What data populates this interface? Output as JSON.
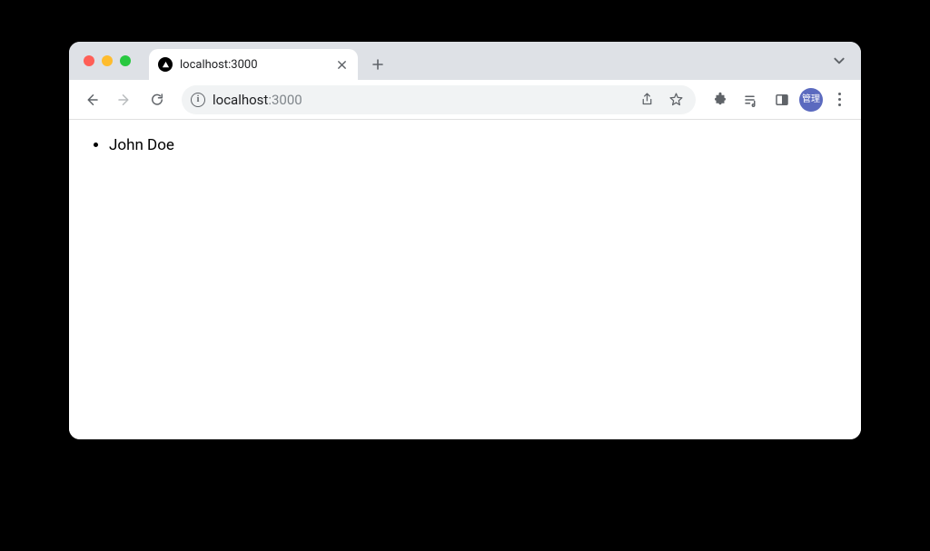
{
  "tab": {
    "title": "localhost:3000",
    "favicon": "triangle-in-circle"
  },
  "address_bar": {
    "host": "localhost",
    "port": ":3000"
  },
  "profile": {
    "avatar_label": "管理"
  },
  "content": {
    "list_items": [
      "John Doe"
    ]
  }
}
